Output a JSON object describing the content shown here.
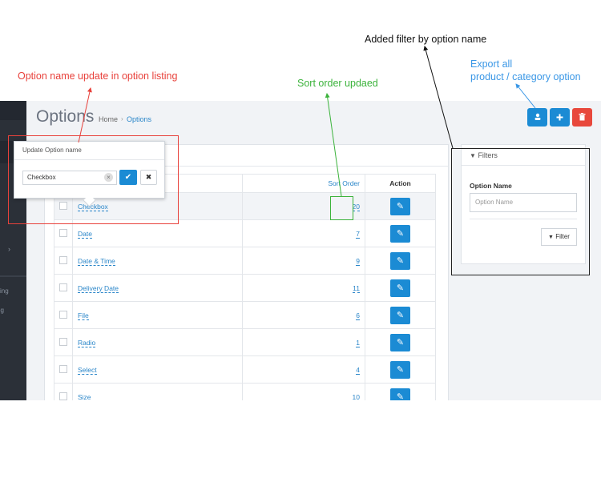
{
  "annotations": {
    "option_name_update": "Option name update in option listing",
    "sort_order": "Sort order updaed",
    "added_filter": "Added filter by option name",
    "export_line1": "Export all",
    "export_line2": "product / category option"
  },
  "header": {
    "title": "Options",
    "breadcrumb": {
      "home": "Home",
      "separator": "›",
      "current": "Options"
    }
  },
  "toolbar": {
    "export_icon": "user-icon",
    "add_icon": "plus-icon",
    "delete_icon": "trash-icon",
    "colors": {
      "primary": "#1b8bd4",
      "danger": "#e8483c"
    }
  },
  "sidebar": {
    "labels": [
      "sing",
      "og"
    ],
    "chevron": "›"
  },
  "table": {
    "columns": {
      "sort": "Sort Order",
      "action": "Action"
    },
    "rows": [
      {
        "name": "Checkbox",
        "sort": "20"
      },
      {
        "name": "Date",
        "sort": "7"
      },
      {
        "name": "Date & Time",
        "sort": "9"
      },
      {
        "name": "Delivery Date",
        "sort": "11"
      },
      {
        "name": "File",
        "sort": "6"
      },
      {
        "name": "Radio",
        "sort": "1"
      },
      {
        "name": "Select",
        "sort": "4"
      },
      {
        "name": "Size",
        "sort": "10"
      }
    ]
  },
  "popup": {
    "title": "Update Option name",
    "value": "Checkbox"
  },
  "filters": {
    "title": "Filters",
    "label": "Option Name",
    "placeholder": "Option Name",
    "button": "Filter"
  }
}
